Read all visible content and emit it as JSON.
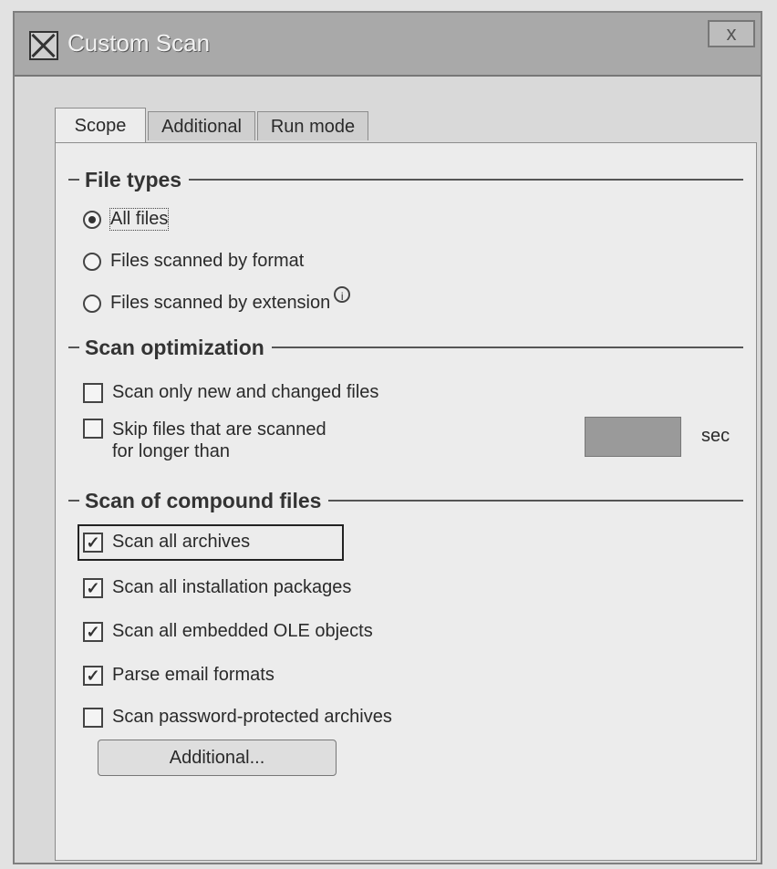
{
  "window": {
    "title": "Custom Scan",
    "close_label": "x"
  },
  "tabs": [
    {
      "label": "Scope",
      "active": true
    },
    {
      "label": "Additional",
      "active": false
    },
    {
      "label": "Run mode",
      "active": false
    }
  ],
  "file_types": {
    "heading": "File types",
    "options": [
      {
        "label": "All files",
        "selected": true
      },
      {
        "label": "Files scanned by format",
        "selected": false
      },
      {
        "label": "Files scanned by extension",
        "selected": false
      }
    ],
    "info_icon": "info-icon"
  },
  "scan_optimization": {
    "heading": "Scan optimization",
    "new_changed_label": "Scan only new and changed files",
    "new_changed_checked": false,
    "skip_label_1": "Skip files that are scanned",
    "skip_label_2": "for longer than",
    "skip_checked": false,
    "seconds_value": "",
    "seconds_unit": "sec"
  },
  "compound_files": {
    "heading": "Scan of compound files",
    "items": [
      {
        "label": "Scan all archives",
        "checked": true
      },
      {
        "label": "Scan all installation packages",
        "checked": true
      },
      {
        "label": "Scan all embedded OLE objects",
        "checked": true
      },
      {
        "label": "Parse email formats",
        "checked": true
      },
      {
        "label": "Scan password-protected archives",
        "checked": false
      }
    ],
    "additional_button": "Additional..."
  }
}
